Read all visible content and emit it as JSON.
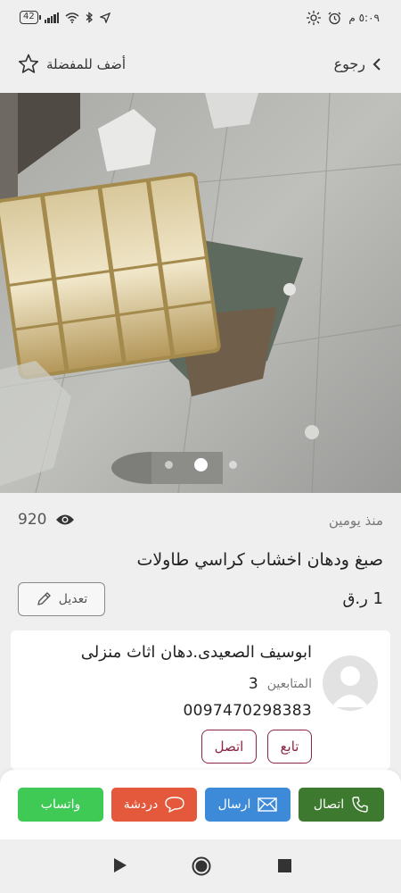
{
  "status_bar": {
    "battery": "42",
    "time": "٥:٠٩ م"
  },
  "header": {
    "back_label": "رجوع",
    "favorite_label": "أضف للمفضلة"
  },
  "gallery": {
    "image_count": 3,
    "active_index": 1
  },
  "listing": {
    "views": "920",
    "posted": "منذ يومين",
    "title": "صبغ ودهان اخشاب كراسي طاولات",
    "price": "1 ر.ق",
    "edit_label": "تعديل"
  },
  "seller": {
    "name": "ابوسيف الصعيدى.دهان اثاث منزلى",
    "followers_label": "المتابعين",
    "followers_count": "3",
    "phone": "0097470298383",
    "follow_label": "تابع",
    "call_label": "اتصل"
  },
  "actions": {
    "call": "اتصال",
    "send": "ارسال",
    "chat": "دردشة",
    "whatsapp": "واتساب"
  },
  "colors": {
    "call": "#3d7a2f",
    "send": "#3d8ad8",
    "chat": "#e4583b",
    "whatsapp": "#3fca55",
    "accent": "#8a2744"
  }
}
